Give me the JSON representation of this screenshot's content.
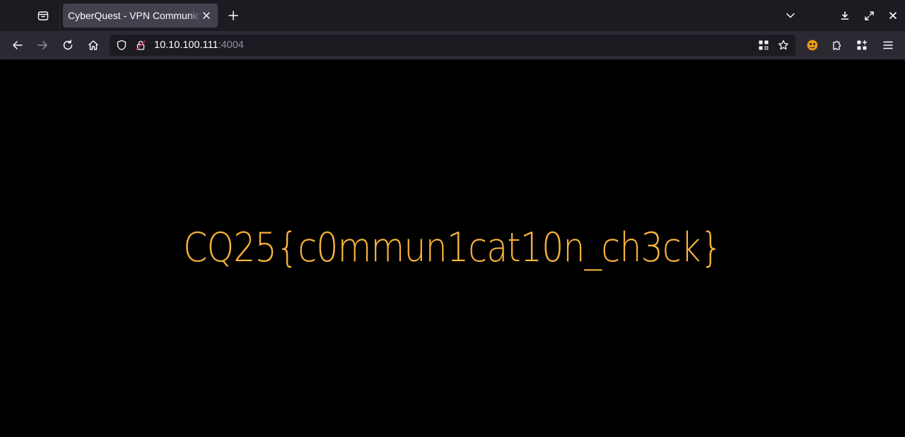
{
  "browser": {
    "tab": {
      "title": "CyberQuest - VPN Communication Check",
      "favicon_icon": "none"
    },
    "toolbar_icons": {
      "tab_list": "tab-list-icon",
      "new_tab": "plus-icon",
      "list_all_tabs": "chevron-down-icon",
      "downloads": "download-icon",
      "fullscreen": "expand-icon",
      "close_window": "close-icon"
    },
    "address_bar": {
      "host": "10.10.100.111",
      "port": ":4004",
      "security_icon": "shield-icon",
      "lock_icon": "insecure-lock-icon"
    },
    "nav_icons": [
      "back-arrow-icon",
      "forward-arrow-icon",
      "reload-icon",
      "home-icon"
    ],
    "right_icons": [
      "qr-code-icon",
      "star-icon",
      "extension-avatar-icon",
      "puzzle-icon",
      "apps-grid-icon",
      "hamburger-menu-icon"
    ]
  },
  "page": {
    "flag_text": "CQ25{c0mmun1cat10n_ch3ck}",
    "colors": {
      "background": "#000000",
      "flag_color": "#f6b23b"
    }
  }
}
